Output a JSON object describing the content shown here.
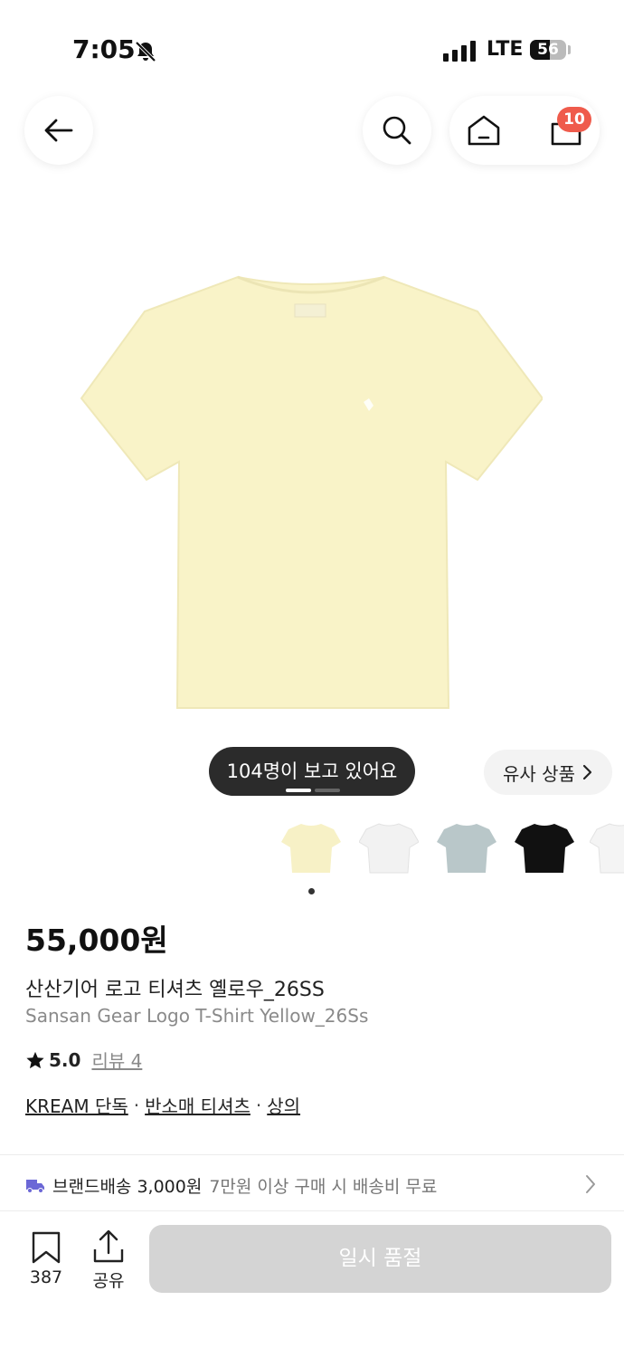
{
  "status_bar": {
    "time": "7:05",
    "network": "LTE",
    "battery": "56",
    "battery_level": 0.56
  },
  "header": {
    "back_icon": "arrow-left-icon",
    "search_icon": "search-icon",
    "home_icon": "home-icon",
    "cart_icon": "shopping-bag-icon",
    "cart_count": "10"
  },
  "gallery": {
    "viewers_text": "104명이 보고 있어요",
    "similar_label": "유사 상품",
    "main_color": "#f9f3c8",
    "thumbnail_colors": [
      "#f7f1c6",
      "#f2f2f2",
      "#b9c7c9",
      "#111111",
      "#f4f4f4"
    ]
  },
  "product": {
    "price": "55,000원",
    "name_ko": "산산기어 로고 티셔츠 옐로우_26SS",
    "name_en": "Sansan Gear Logo T-Shirt Yellow_26Ss",
    "rating": "5.0",
    "review_label": "리뷰 4",
    "tags": [
      "KREAM 단독",
      "반소매 티셔츠",
      "상의"
    ],
    "tag_separator": "·"
  },
  "shipping": {
    "label": "브랜드배송 3,000원",
    "note": "7만원 이상 구매 시 배송비 무료"
  },
  "bottom_bar": {
    "save_count": "387",
    "share_label": "공유",
    "sold_out_label": "일시 품절"
  }
}
